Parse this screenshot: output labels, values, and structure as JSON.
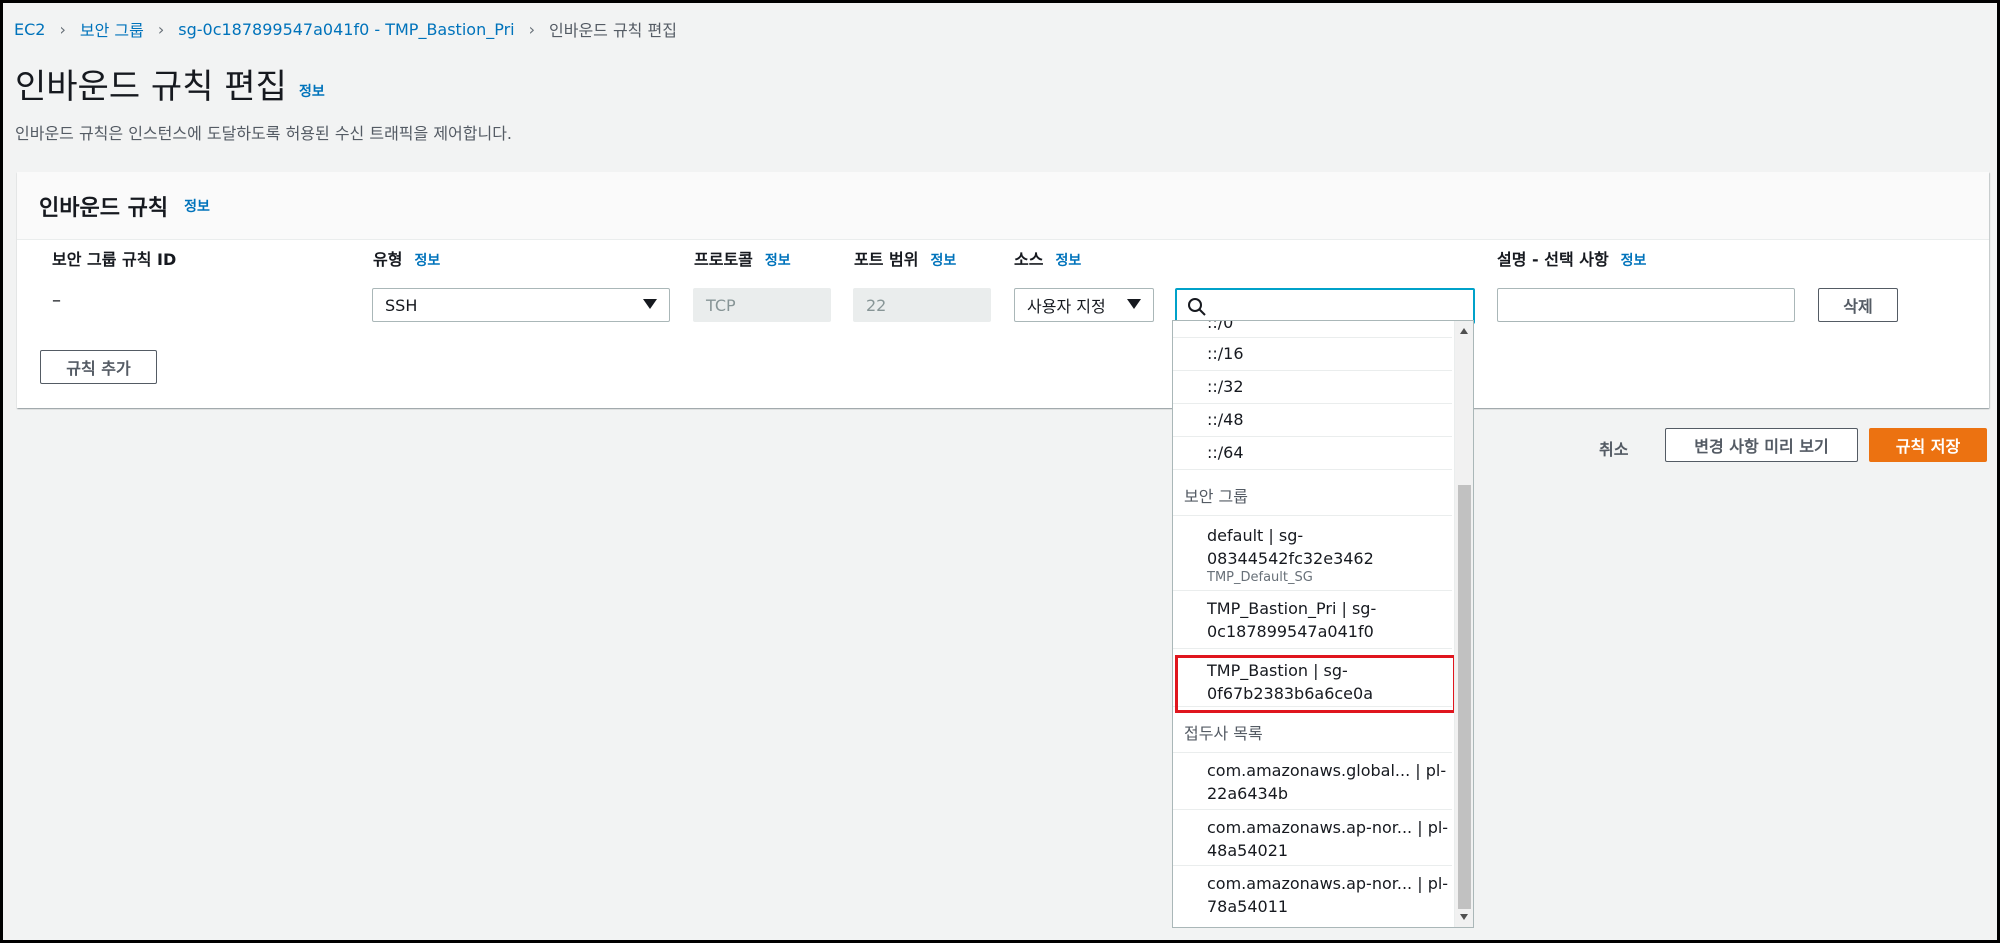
{
  "breadcrumb": {
    "items": [
      "EC2",
      "보안 그룹",
      "sg-0c187899547a041f0 - TMP_Bastion_Pri"
    ],
    "current": "인바운드 규칙 편집"
  },
  "page": {
    "title": "인바운드 규칙 편집",
    "info": "정보",
    "description": "인바운드 규칙은 인스턴스에 도달하도록 허용된 수신 트래픽을 제어합니다."
  },
  "panel": {
    "title": "인바운드 규칙",
    "info": "정보",
    "columns": {
      "rule_id": "보안 그룹 규칙 ID",
      "type": "유형",
      "protocol": "프로토콜",
      "port_range": "포트 범위",
      "source": "소스",
      "description": "설명 - 선택 사항",
      "info": "정보"
    },
    "row": {
      "rule_id": "–",
      "type": "SSH",
      "protocol": "TCP",
      "port": "22",
      "source_type": "사용자 지정",
      "search_value": "",
      "description_value": "",
      "delete_label": "삭제"
    },
    "add_rule_label": "규칙 추가"
  },
  "actions": {
    "cancel": "취소",
    "preview": "변경 사항 미리 보기",
    "save": "규칙 저장"
  },
  "dropdown": {
    "ipv6": [
      "::/0",
      "::/16",
      "::/32",
      "::/48",
      "::/64"
    ],
    "security_group_header": "보안 그룹",
    "security_groups": [
      {
        "line1": "default | sg-",
        "line2": "08344542fc32e3462",
        "sub": "TMP_Default_SG"
      },
      {
        "line1": "TMP_Bastion_Pri | sg-",
        "line2": "0c187899547a041f0"
      },
      {
        "line1": "TMP_Bastion | sg-",
        "line2": "0f67b2383b6a6ce0a"
      }
    ],
    "prefix_list_header": "접두사 목록",
    "prefix_lists": [
      {
        "line1": "com.amazonaws.global... | pl-",
        "line2": "22a6434b"
      },
      {
        "line1": "com.amazonaws.ap-nor... | pl-",
        "line2": "48a54021"
      },
      {
        "line1": "com.amazonaws.ap-nor... | pl-",
        "line2": "78a54011"
      }
    ]
  },
  "colors": {
    "link": "#0073bb",
    "primary": "#ec7211",
    "focus": "#00a1c9",
    "highlight": "#e0161e"
  }
}
